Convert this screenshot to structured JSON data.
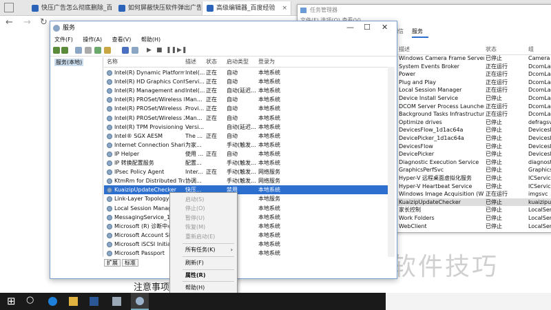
{
  "browser": {
    "tabs": [
      {
        "label": "快压广告怎么彻底删除_百度"
      },
      {
        "label": "如何屏蔽快压软件弹出广告"
      },
      {
        "label": "高级编辑器_百度经验"
      }
    ],
    "close_glyph": "×",
    "new_tab_glyph": "+",
    "back_glyph": "←",
    "forward_glyph": "→",
    "refresh_glyph": "↻"
  },
  "page": {
    "notice": "注意事项",
    "watermark": "软件技巧"
  },
  "task_manager": {
    "title": "任务管理器",
    "menu": "文件(F) 选项(O) 查看(V)",
    "tabs_label": "详细信息",
    "tab_services": "服务",
    "headers": {
      "desc": "描述",
      "status": "状态",
      "group": "组"
    },
    "rows": [
      {
        "desc": "Windows Camera Frame Server",
        "status": "已停止",
        "group": "Camera"
      },
      {
        "desc": "System Events Broker",
        "status": "正在运行",
        "group": "DcomLau"
      },
      {
        "desc": "Power",
        "status": "正在运行",
        "group": "DcomLau"
      },
      {
        "desc": "Plug and Play",
        "status": "正在运行",
        "group": "DcomLau"
      },
      {
        "desc": "Local Session Manager",
        "status": "正在运行",
        "group": "DcomLau"
      },
      {
        "desc": "Device Install Service",
        "status": "已停止",
        "group": "DcomLau"
      },
      {
        "desc": "DCOM Server Process Launcher",
        "status": "正在运行",
        "group": "DcomLau"
      },
      {
        "desc": "Background Tasks Infrastructur...",
        "status": "正在运行",
        "group": "DcomLau"
      },
      {
        "desc": "Optimize drives",
        "status": "已停止",
        "group": "defragsvc"
      },
      {
        "desc": "DevicesFlow_1d1ac64a",
        "status": "已停止",
        "group": "DevicesFl"
      },
      {
        "desc": "DevicePicker_1d1ac64a",
        "status": "已停止",
        "group": "DevicesFl"
      },
      {
        "desc": "DevicesFlow",
        "status": "已停止",
        "group": "DevicesFl"
      },
      {
        "desc": "DevicePicker",
        "status": "已停止",
        "group": "DevicesFl"
      },
      {
        "desc": "Diagnostic Execution Service",
        "status": "已停止",
        "group": "diagnostic"
      },
      {
        "desc": "GraphicsPerfSvc",
        "status": "已停止",
        "group": "GraphicsP"
      },
      {
        "desc": "Hyper-V 远程桌面虚拟化服务",
        "status": "已停止",
        "group": "ICService"
      },
      {
        "desc": "Hyper-V Heartbeat Service",
        "status": "已停止",
        "group": "ICService"
      },
      {
        "desc": "Windows Image Acquisition (WI",
        "status": "正在运行",
        "group": "imgsvc"
      },
      {
        "desc": "KuaizipUpdateChecker",
        "status": "已停止",
        "group": "kuaizipup"
      },
      {
        "desc": "家长控制",
        "status": "已停止",
        "group": "LocalServi"
      },
      {
        "desc": "Work Folders",
        "status": "已停止",
        "group": "LocalServi"
      },
      {
        "desc": "WebClient",
        "status": "已停止",
        "group": "LocalServi"
      }
    ],
    "selected_index": 18
  },
  "services": {
    "title": "服务",
    "menu": [
      "文件(F)",
      "操作(A)",
      "查看(V)",
      "帮助(H)"
    ],
    "tree_item": "服务(本地)",
    "headers": {
      "name": "名称",
      "desc": "描述",
      "status": "状态",
      "startup": "启动类型",
      "logon": "登录为"
    },
    "rows": [
      {
        "name": "Intel(R) Dynamic Platform ...",
        "desc": "Intel(...",
        "status": "正在",
        "startup": "自动",
        "logon": "本地系统"
      },
      {
        "name": "Intel(R) HD Graphics Contr...",
        "desc": "Servi...",
        "status": "正在",
        "startup": "自动",
        "logon": "本地系统"
      },
      {
        "name": "Intel(R) Management and ...",
        "desc": "Intel(...",
        "status": "正在",
        "startup": "自动(延迟...",
        "logon": "本地系统"
      },
      {
        "name": "Intel(R) PROSet/Wireless E...",
        "desc": "Man...",
        "status": "正在",
        "startup": "自动",
        "logon": "本地系统"
      },
      {
        "name": "Intel(R) PROSet/Wireless ...",
        "desc": "Provi...",
        "status": "正在",
        "startup": "自动",
        "logon": "本地系统"
      },
      {
        "name": "Intel(R) PROSet/Wireless Z...",
        "desc": "Man...",
        "status": "正在",
        "startup": "自动",
        "logon": "本地系统"
      },
      {
        "name": "Intel(R) TPM Provisioning S...",
        "desc": "Versi...",
        "status": "",
        "startup": "自动(延迟...",
        "logon": "本地系统"
      },
      {
        "name": "Intel® SGX AESM",
        "desc": "The ...",
        "status": "正在",
        "startup": "自动",
        "logon": "本地系统"
      },
      {
        "name": "Internet Connection Sharin...",
        "desc": "为家...",
        "status": "",
        "startup": "手动(触发...",
        "logon": "本地系统"
      },
      {
        "name": "IP Helper",
        "desc": "使用 ...",
        "status": "正在",
        "startup": "自动",
        "logon": "本地系统"
      },
      {
        "name": "IP 转换配置服务",
        "desc": "配置...",
        "status": "",
        "startup": "手动(触发...",
        "logon": "本地系统"
      },
      {
        "name": "IPsec Policy Agent",
        "desc": "Inter...",
        "status": "正在",
        "startup": "手动(触发...",
        "logon": "网络服务"
      },
      {
        "name": "KtmRm for Distributed Tra...",
        "desc": "协调...",
        "status": "",
        "startup": "手动(触发...",
        "logon": "网络服务"
      },
      {
        "name": "KuaizipUpdateChecker",
        "desc": "快压...",
        "status": "",
        "startup": "禁用",
        "logon": "本地系统"
      },
      {
        "name": "Link-Layer Topology Dis",
        "desc": "",
        "status": "",
        "startup": "",
        "logon": "本地服务"
      },
      {
        "name": "Local Session Manager",
        "desc": "",
        "status": "",
        "startup": "",
        "logon": "本地系统"
      },
      {
        "name": "MessagingService_1d1a",
        "desc": "",
        "status": "",
        "startup": "",
        "logon": "本地系统"
      },
      {
        "name": "Microsoft (R) 诊断中心标",
        "desc": "",
        "status": "",
        "startup": "",
        "logon": "本地系统"
      },
      {
        "name": "Microsoft Account Sign-",
        "desc": "",
        "status": "",
        "startup": "",
        "logon": "本地系统"
      },
      {
        "name": "Microsoft iSCSI Initiator",
        "desc": "",
        "status": "",
        "startup": "",
        "logon": "本地系统"
      },
      {
        "name": "Microsoft Passport",
        "desc": "",
        "status": "",
        "startup": "",
        "logon": "本地系统"
      }
    ],
    "selected_index": 13,
    "bottom_tabs": [
      "扩展",
      "标准"
    ]
  },
  "context_menu": {
    "items_top": [
      "启动(S)",
      "停止(O)",
      "暂停(U)",
      "恢复(M)",
      "重新启动(E)"
    ],
    "all_tasks": "所有任务(K)",
    "submenu_arrow": "›",
    "refresh": "刷新(F)",
    "properties": "属性(R)",
    "help": "帮助(H)"
  },
  "taskbar": {
    "win_glyph": "⊞",
    "search_glyph": "○"
  },
  "colors": {
    "selection": "#2d6fcf",
    "taskbar": "#1a1a1a",
    "tab_favicon": "#2b63b9"
  }
}
